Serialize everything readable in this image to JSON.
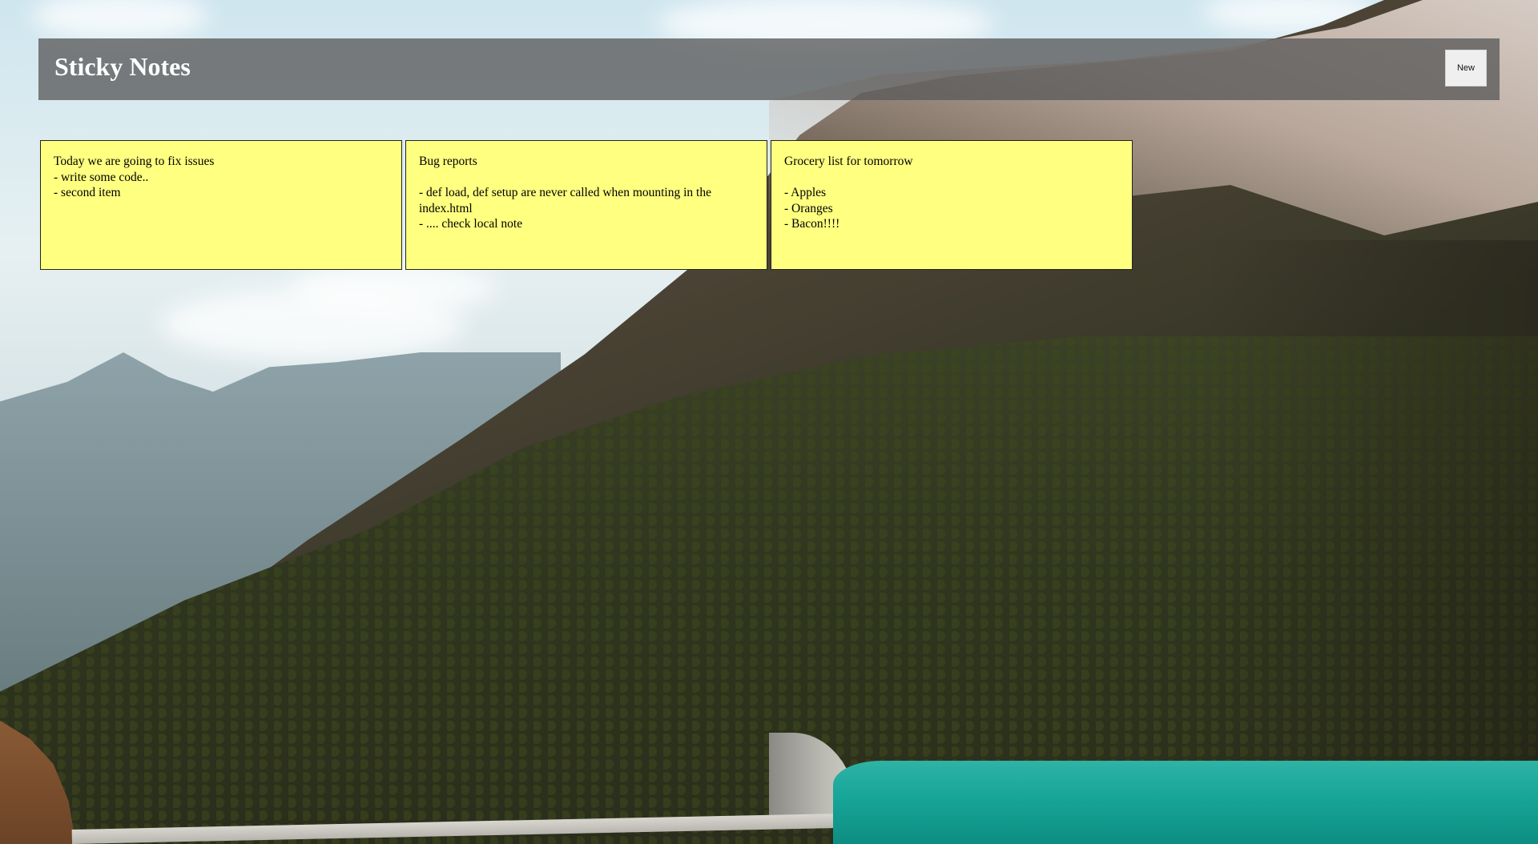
{
  "header": {
    "title": "Sticky Notes",
    "new_button_label": "New"
  },
  "notes": [
    {
      "text": "Today we are going to fix issues\n- write some code..\n- second item"
    },
    {
      "text": "Bug reports\n\n- def load, def setup are never called when mounting in the index.html\n- .... check local note"
    },
    {
      "text": "Grocery list for tomorrow\n\n- Apples\n- Oranges\n- Bacon!!!!"
    }
  ],
  "colors": {
    "note_background": "#ffff80",
    "header_background": "rgba(90,90,90,0.78)",
    "title_color": "#ffffff"
  }
}
